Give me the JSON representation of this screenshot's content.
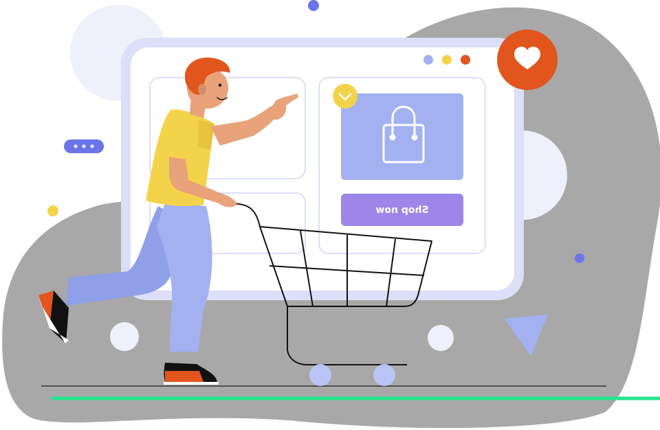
{
  "browser_card": {
    "cta_label": "Shop now"
  },
  "icons": {
    "favorite": "heart-icon",
    "product": "shopping-bag-icon",
    "dropdown": "chevron-down-icon",
    "typing": "ellipsis-icon",
    "window_dots": "window-controls-icon",
    "cart": "shopping-cart-icon"
  },
  "colors": {
    "blob": "#a8a8a8",
    "window_frame": "#dcdff7",
    "window_inner": "#eef0fb",
    "accent_orange": "#e2551d",
    "accent_yellow": "#f3d34a",
    "accent_blue": "#a3b1f1",
    "accent_purple": "#9e86e8",
    "ground_line": "#24e38f"
  }
}
